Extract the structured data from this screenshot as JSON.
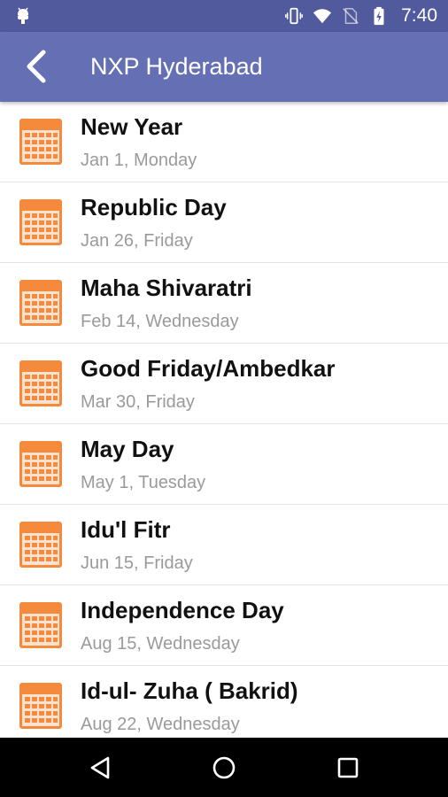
{
  "status_bar": {
    "time": "7:40",
    "icons": [
      "android-debug-icon",
      "vibrate-icon",
      "wifi-icon",
      "no-sim-icon",
      "battery-charging-icon"
    ]
  },
  "app_bar": {
    "title": "NXP Hyderabad",
    "back_icon": "back-arrow-icon"
  },
  "holidays": [
    {
      "name": "New Year",
      "date": "Jan 1, Monday"
    },
    {
      "name": "Republic Day",
      "date": "Jan 26, Friday"
    },
    {
      "name": "Maha Shivaratri",
      "date": "Feb 14, Wednesday"
    },
    {
      "name": "Good Friday/Ambedkar",
      "date": "Mar 30, Friday"
    },
    {
      "name": "May Day",
      "date": "May 1, Tuesday"
    },
    {
      "name": "Idu'l Fitr",
      "date": "Jun 15, Friday"
    },
    {
      "name": "Independence Day",
      "date": "Aug 15, Wednesday"
    },
    {
      "name": "Id-ul- Zuha ( Bakrid)",
      "date": "Aug 22, Wednesday"
    }
  ],
  "colors": {
    "status_bar": "#505a9d",
    "app_bar": "#6570b4",
    "calendar_icon": "#f58a3c"
  },
  "nav_bar": {
    "icons": [
      "back-triangle-icon",
      "home-circle-icon",
      "recents-square-icon"
    ]
  }
}
